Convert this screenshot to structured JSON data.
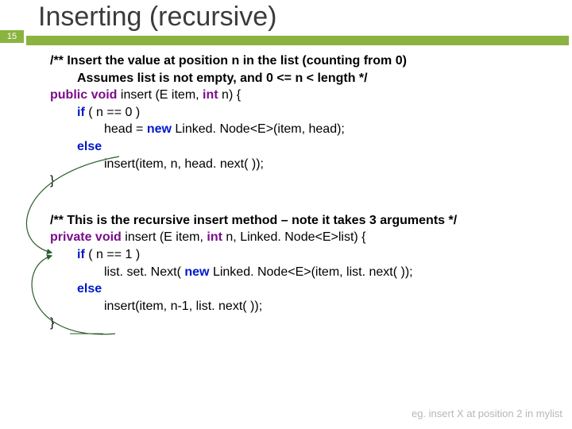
{
  "page_number": "15",
  "title": "Inserting (recursive)",
  "method1": {
    "comment_line1": "/** Insert the value at position n in the list (counting from 0)",
    "comment_line2": "Assumes list is not empty, and 0 <= n < length */",
    "kw_public": "public",
    "kw_void1": "void",
    "sig_name": " insert (E item, ",
    "kw_int1": "int",
    "sig_rest": " n) {",
    "kw_if": "if",
    "if_cond": " ( n == 0 )",
    "assign_head": "head = ",
    "kw_new1": "new",
    "new_node": " Linked. Node<E>(item, head);",
    "kw_else": "else",
    "recurse_call": "insert(item, n, head. next( ));",
    "close_brace": "}"
  },
  "method2": {
    "comment": "/** This is the recursive insert method – note it takes 3 arguments */",
    "kw_private": "private",
    "kw_void2": "void",
    "sig_name2": " insert (E item, ",
    "kw_int2": "int",
    "sig_mid2": " n, Linked. Node<E>list) {",
    "kw_if2": "if",
    "if_cond2": " ( n == 1 )",
    "setnext_pre": "list. set. Next(",
    "kw_new2": "new",
    "setnext_post": " Linked. Node<E>(item, list. next( ));",
    "kw_else2": "else",
    "recurse_call2": "insert(item, n-1, list. next( ));",
    "close_brace2": "}"
  },
  "example_text": "eg. insert X at position 2 in mylist"
}
